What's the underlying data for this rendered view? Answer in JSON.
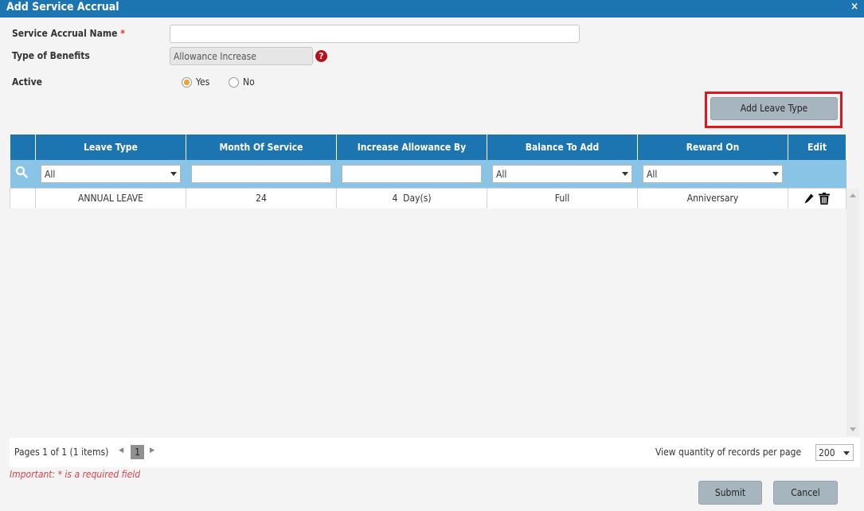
{
  "window": {
    "title": "Add Service Accrual",
    "close": "×"
  },
  "form": {
    "name_label": "Service Accrual Name",
    "required_mark": "*",
    "name_value": "",
    "benefits_label": "Type of Benefits",
    "benefits_value": "Allowance Increase",
    "help": "?",
    "active_label": "Active",
    "active_options": [
      "Yes",
      "No"
    ],
    "active_selected": "Yes"
  },
  "add_leave_type_button": "Add Leave Type",
  "grid": {
    "columns": [
      "Leave Type",
      "Month Of Service",
      "Increase Allowance By",
      "Balance To Add",
      "Reward On",
      "Edit"
    ],
    "filters": {
      "leave_type": "All",
      "month_of_service": "",
      "increase_allowance_by": "",
      "balance_to_add": "All",
      "reward_on": "All"
    },
    "rows": [
      {
        "leave_type": "ANNUAL LEAVE",
        "month_of_service": "24",
        "increase_allowance_by": "4  Day(s)",
        "balance_to_add": "Full",
        "reward_on": "Anniversary"
      }
    ]
  },
  "pager": {
    "info": "Pages 1 of 1 (1 items)",
    "current_page": "1",
    "records_label": "View quantity of records per page",
    "records_value": "200"
  },
  "important_note": "Important: * is a required field",
  "buttons": {
    "submit": "Submit",
    "cancel": "Cancel"
  },
  "colors": {
    "header": "#1c74b0",
    "filter_row": "#89c4e6",
    "highlight": "#e0151d",
    "required": "#d9382c"
  }
}
